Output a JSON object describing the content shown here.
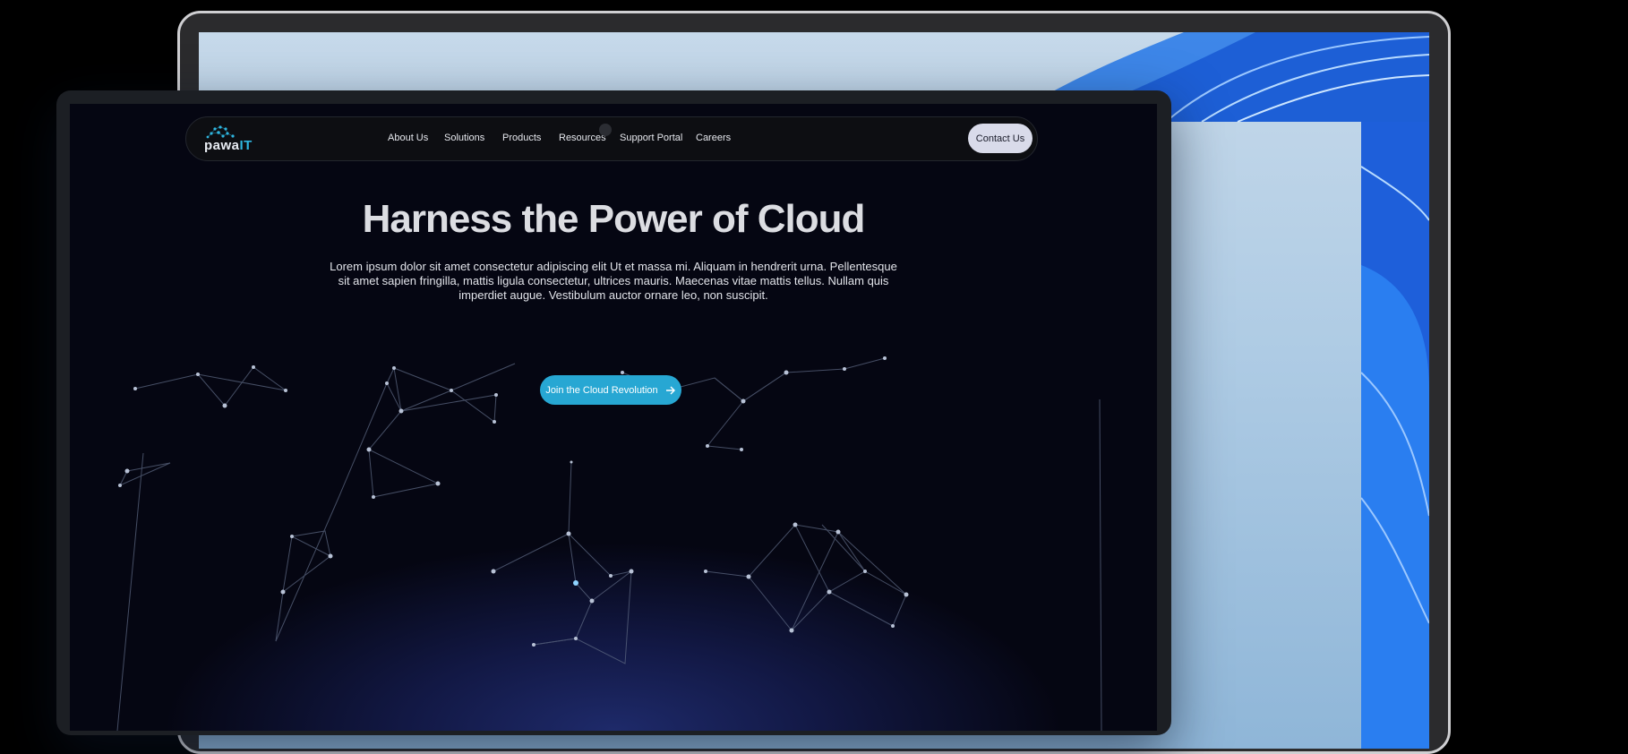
{
  "site": {
    "logo": {
      "text_main": "pawa",
      "text_accent": "IT"
    },
    "nav": {
      "items": [
        {
          "label": "About Us"
        },
        {
          "label": "Solutions"
        },
        {
          "label": "Products"
        },
        {
          "label": "Resources"
        },
        {
          "label": "Support Portal"
        },
        {
          "label": "Careers"
        }
      ],
      "contact_label": "Contact Us"
    },
    "hero": {
      "title": "Harness the Power of Cloud",
      "body": "Lorem ipsum dolor sit amet consectetur adipiscing elit Ut et massa mi. Aliquam in hendrerit urna. Pellentesque sit amet sapien fringilla, mattis ligula consectetur, ultrices mauris. Maecenas vitae mattis tellus. Nullam quis imperdiet augue. Vestibulum auctor ornare leo, non suscipit.",
      "cta_label": "Join the Cloud Revolution",
      "cta_icon": "arrow-right-icon"
    },
    "colors": {
      "accent": "#27a7d3",
      "contact_button": "#d9dbea",
      "background": "#03040a",
      "glow": "#1e2a6a"
    }
  }
}
